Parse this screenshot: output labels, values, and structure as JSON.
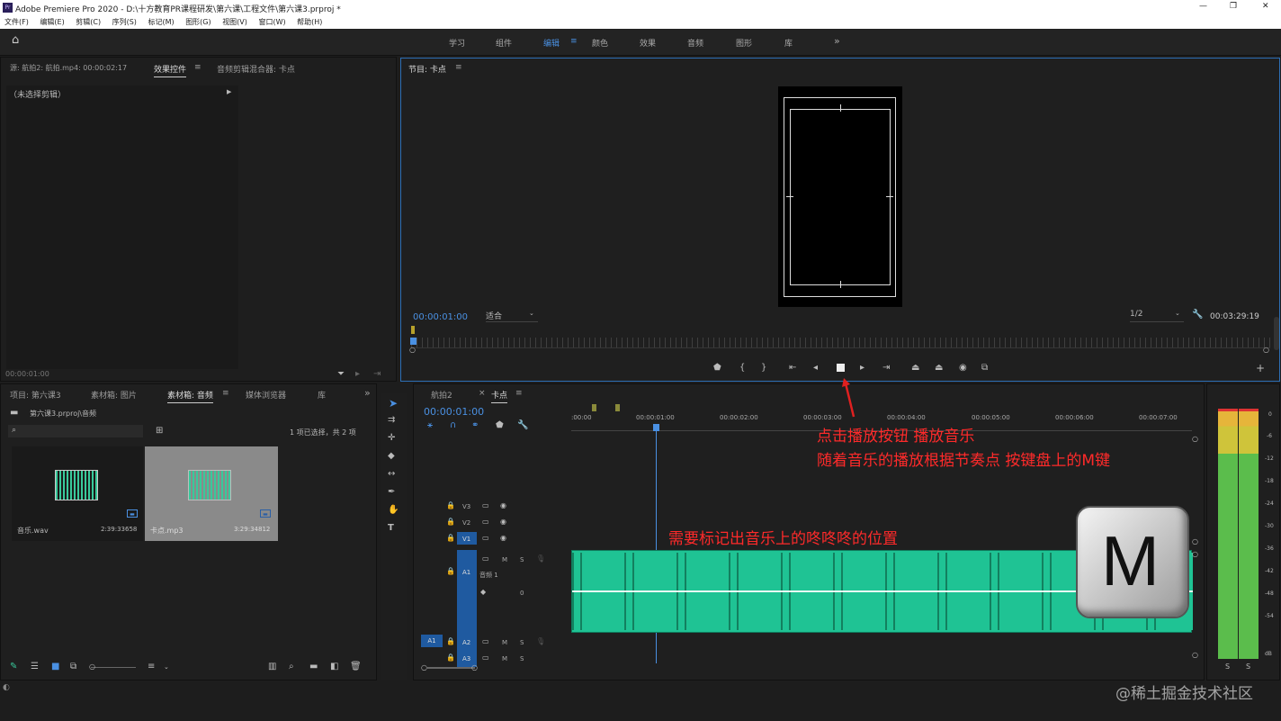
{
  "app": {
    "title": "Adobe Premiere Pro 2020 - D:\\十方教育PR课程研发\\第六课\\工程文件\\第六课3.prproj *",
    "logo_text": "Pr",
    "window_controls": [
      "—",
      "❐",
      "✕"
    ]
  },
  "menu": [
    "文件(F)",
    "编辑(E)",
    "剪辑(C)",
    "序列(S)",
    "标记(M)",
    "图形(G)",
    "视图(V)",
    "窗口(W)",
    "帮助(H)"
  ],
  "workspaces": [
    "学习",
    "组件",
    "编辑",
    "颜色",
    "效果",
    "音频",
    "图形",
    "库"
  ],
  "workspaces_overflow": "»",
  "active_workspace": "编辑",
  "source_panel": {
    "tabs": [
      "源: 航拍2: 航拍.mp4: 00:00:02:17",
      "效果控件",
      "音频剪辑混合器: 卡点"
    ],
    "no_clip": "（未选择剪辑）",
    "timecode": "00:00:01:00"
  },
  "program_monitor": {
    "title": "节目: 卡点",
    "timecode_left": "00:00:01:00",
    "fit": "适合",
    "resolution": "1/2",
    "timecode_right": "00:03:29:19"
  },
  "project_panel": {
    "tabs": [
      "项目: 第六课3",
      "素材箱: 图片",
      "素材箱: 音频",
      "媒体浏览器",
      "库"
    ],
    "overflow": "»",
    "path": "第六课3.prproj\\音频",
    "selection": "1 项已选择，共 2 项",
    "items": [
      {
        "name": "音乐.wav",
        "duration": "2:39:33658"
      },
      {
        "name": "卡点.mp3",
        "duration": "3:29:34812"
      }
    ]
  },
  "timeline": {
    "tabs": [
      "航拍2",
      "卡点"
    ],
    "close_mark": "×",
    "timecode": "00:00:01:00",
    "ruler": [
      ":00:00",
      "00:00:01:00",
      "00:00:02:00",
      "00:00:03:00",
      "00:00:04:00",
      "00:00:05:00",
      "00:00:06:00",
      "00:00:07:00"
    ],
    "tracks": [
      "V3",
      "V2",
      "V1",
      "A1",
      "A2",
      "A3"
    ],
    "track_name_a1": "音频 1",
    "mute_label": "M",
    "solo_label": "S",
    "volume_value": "0"
  },
  "meter": {
    "labels": [
      "0",
      "-6",
      "-12",
      "-18",
      "-24",
      "-30",
      "-36",
      "-42",
      "-48",
      "-54",
      "dB"
    ],
    "solo": [
      "S",
      "S"
    ]
  },
  "annotations": {
    "line1": "点击播放按钮 播放音乐",
    "line2": "随着音乐的播放根据节奏点 按键盘上的M键",
    "line3": "需要标记出音乐上的咚咚咚的位置",
    "key": "M"
  },
  "watermark": "@稀土掘金技术社区"
}
